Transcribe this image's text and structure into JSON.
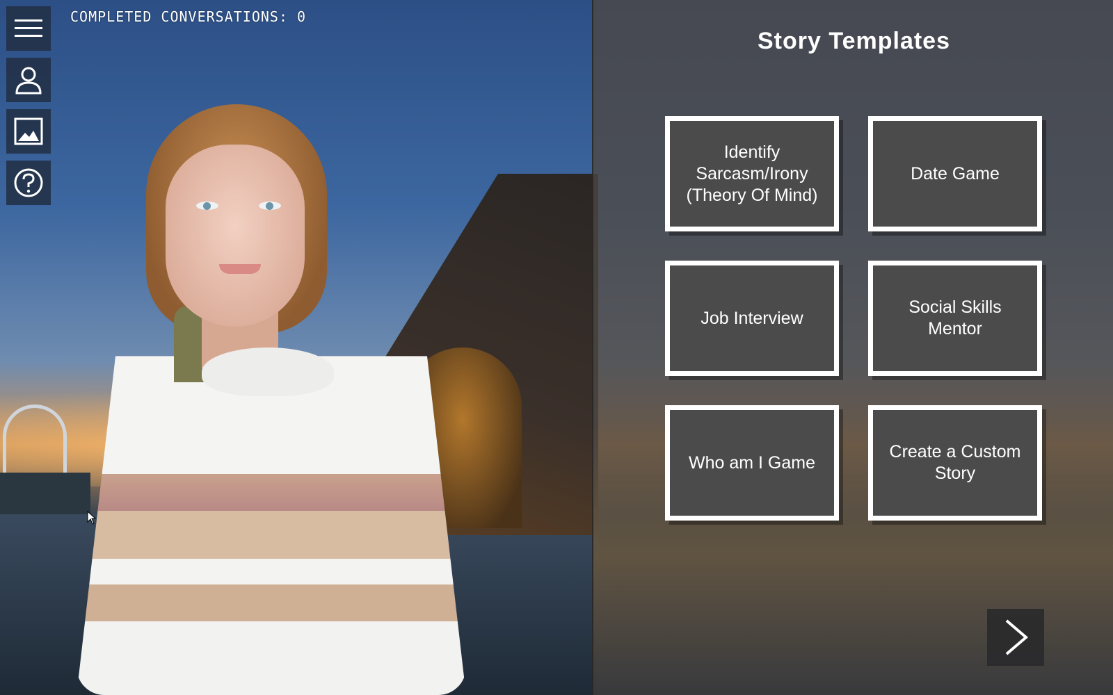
{
  "status": {
    "completed_conversations": "COMPLETED CONVERSATIONS: 0"
  },
  "toolbar": {
    "items": [
      {
        "icon": "menu-icon"
      },
      {
        "icon": "user-icon"
      },
      {
        "icon": "image-icon"
      },
      {
        "icon": "help-icon"
      }
    ]
  },
  "panel": {
    "title": "Story Templates",
    "templates": [
      {
        "label": "Identify Sarcasm/Irony (Theory Of Mind)"
      },
      {
        "label": "Date Game"
      },
      {
        "label": "Job Interview"
      },
      {
        "label": "Social Skills Mentor"
      },
      {
        "label": "Who am I Game"
      },
      {
        "label": "Create a Custom Story"
      }
    ],
    "next_icon": "chevron-right-icon"
  },
  "colors": {
    "panel_bg": "#4e4842",
    "button_bg": "#4b4b4b",
    "button_border": "#ffffff",
    "toolbar_bg": "#22304a"
  }
}
